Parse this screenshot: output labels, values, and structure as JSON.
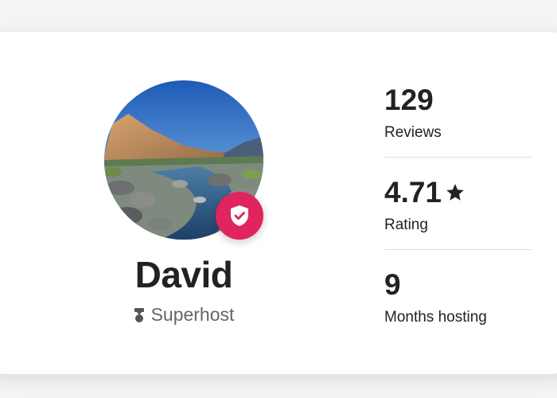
{
  "host": {
    "name": "David",
    "type_label": "Superhost"
  },
  "stats": [
    {
      "value": "129",
      "label": "Reviews"
    },
    {
      "value": "4.71",
      "label": "Rating"
    },
    {
      "value": "9",
      "label": "Months hosting"
    }
  ],
  "icons": {
    "badge": "verified-shield-icon",
    "superhost": "superhost-medal-icon",
    "rating": "star-icon"
  },
  "colors": {
    "badge": "#e0245e",
    "text": "#222222",
    "muted": "#666666",
    "divider": "#dddddd"
  }
}
